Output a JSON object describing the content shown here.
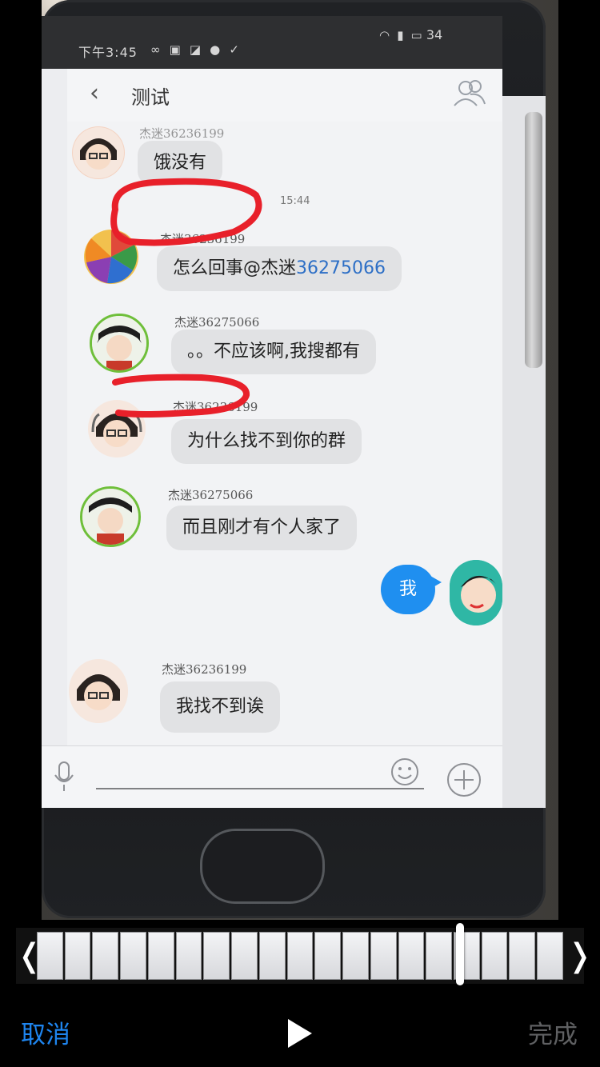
{
  "status_bar": {
    "time": "下午3:45",
    "battery": "34"
  },
  "chat": {
    "title": "测试",
    "messages": [
      {
        "sender": "杰迷36236199",
        "text": "饿没有"
      },
      {
        "time": "15:44"
      },
      {
        "sender": "杰迷36236199",
        "text_prefix": "怎么回事@杰迷",
        "mention": "36275066"
      },
      {
        "sender": "杰迷36275066",
        "text": "。。不应该啊,我搜都有"
      },
      {
        "sender": "杰迷36236199",
        "text": "为什么找不到你的群"
      },
      {
        "sender": "杰迷36275066",
        "text": "而且刚才有个人家了"
      },
      {
        "self": true,
        "text": "我"
      },
      {
        "sender": "杰迷36236199",
        "text": "我找不到诶"
      }
    ]
  },
  "editor": {
    "cancel_label": "取消",
    "done_label": "完成"
  },
  "colors": {
    "accent": "#1e85ef",
    "self_bubble": "#1f8ff0",
    "annotation": "#e8202a"
  }
}
